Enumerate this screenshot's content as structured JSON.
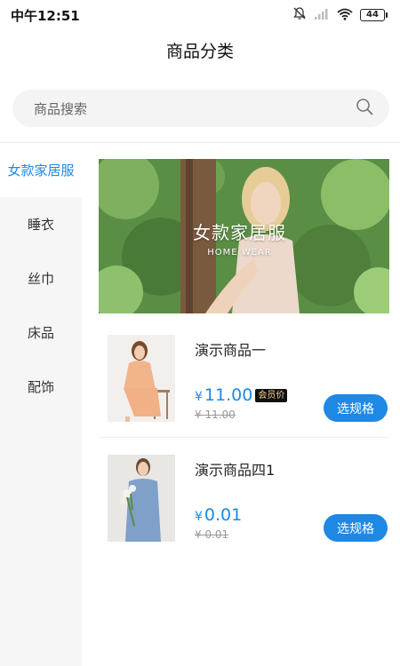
{
  "status_bar": {
    "time": "中午12:51",
    "battery": "44"
  },
  "nav": {
    "title": "商品分类"
  },
  "search": {
    "placeholder": "商品搜索"
  },
  "sidebar": {
    "items": [
      {
        "label": "女款家居服",
        "active": true
      },
      {
        "label": "睡衣",
        "active": false
      },
      {
        "label": "丝巾",
        "active": false
      },
      {
        "label": "床品",
        "active": false
      },
      {
        "label": "配饰",
        "active": false
      }
    ]
  },
  "banner": {
    "title": "女款家居服",
    "subtitle": "HOME WEAR"
  },
  "products": [
    {
      "name": "演示商品一",
      "currency": "¥",
      "price": "11.00",
      "member_badge": "会员价",
      "original_price": "¥ 11.00",
      "button": "选规格"
    },
    {
      "name": "演示商品四1",
      "currency": "¥",
      "price": "0.01",
      "original_price": "¥ 0.01",
      "button": "选规格"
    }
  ],
  "colors": {
    "accent": "#1e88e5",
    "badge_bg": "#111111",
    "badge_text": "#f2d08a"
  }
}
